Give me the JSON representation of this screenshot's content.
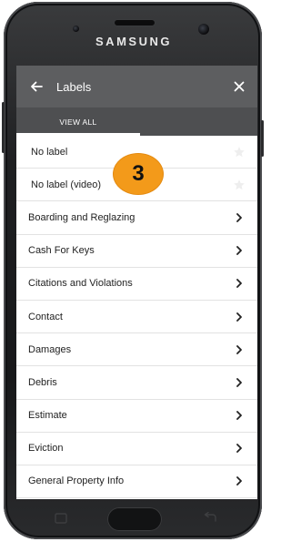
{
  "device": {
    "brand": "SAMSUNG"
  },
  "appbar": {
    "title": "Labels"
  },
  "tabs": [
    {
      "label": "VIEW ALL",
      "active": true
    }
  ],
  "labels_list": [
    {
      "label": "No label",
      "type": "star"
    },
    {
      "label": "No label (video)",
      "type": "star"
    },
    {
      "label": "Boarding and Reglazing",
      "type": "chevron"
    },
    {
      "label": "Cash For Keys",
      "type": "chevron"
    },
    {
      "label": "Citations and Violations",
      "type": "chevron"
    },
    {
      "label": "Contact",
      "type": "chevron"
    },
    {
      "label": "Damages",
      "type": "chevron"
    },
    {
      "label": "Debris",
      "type": "chevron"
    },
    {
      "label": "Estimate",
      "type": "chevron"
    },
    {
      "label": "Eviction",
      "type": "chevron"
    },
    {
      "label": "General Property Info",
      "type": "chevron"
    }
  ],
  "step_badge": {
    "text": "3",
    "color": "#f39a1a"
  },
  "colors": {
    "appbar_bg": "#5d5e60",
    "tabs_bg": "#4e4f51",
    "list_bg": "#ffffff",
    "divider": "#e2e2e2"
  },
  "icons": {
    "back": "arrow-left",
    "close": "x",
    "row_chevron": "chevron-right",
    "row_star": "star"
  }
}
